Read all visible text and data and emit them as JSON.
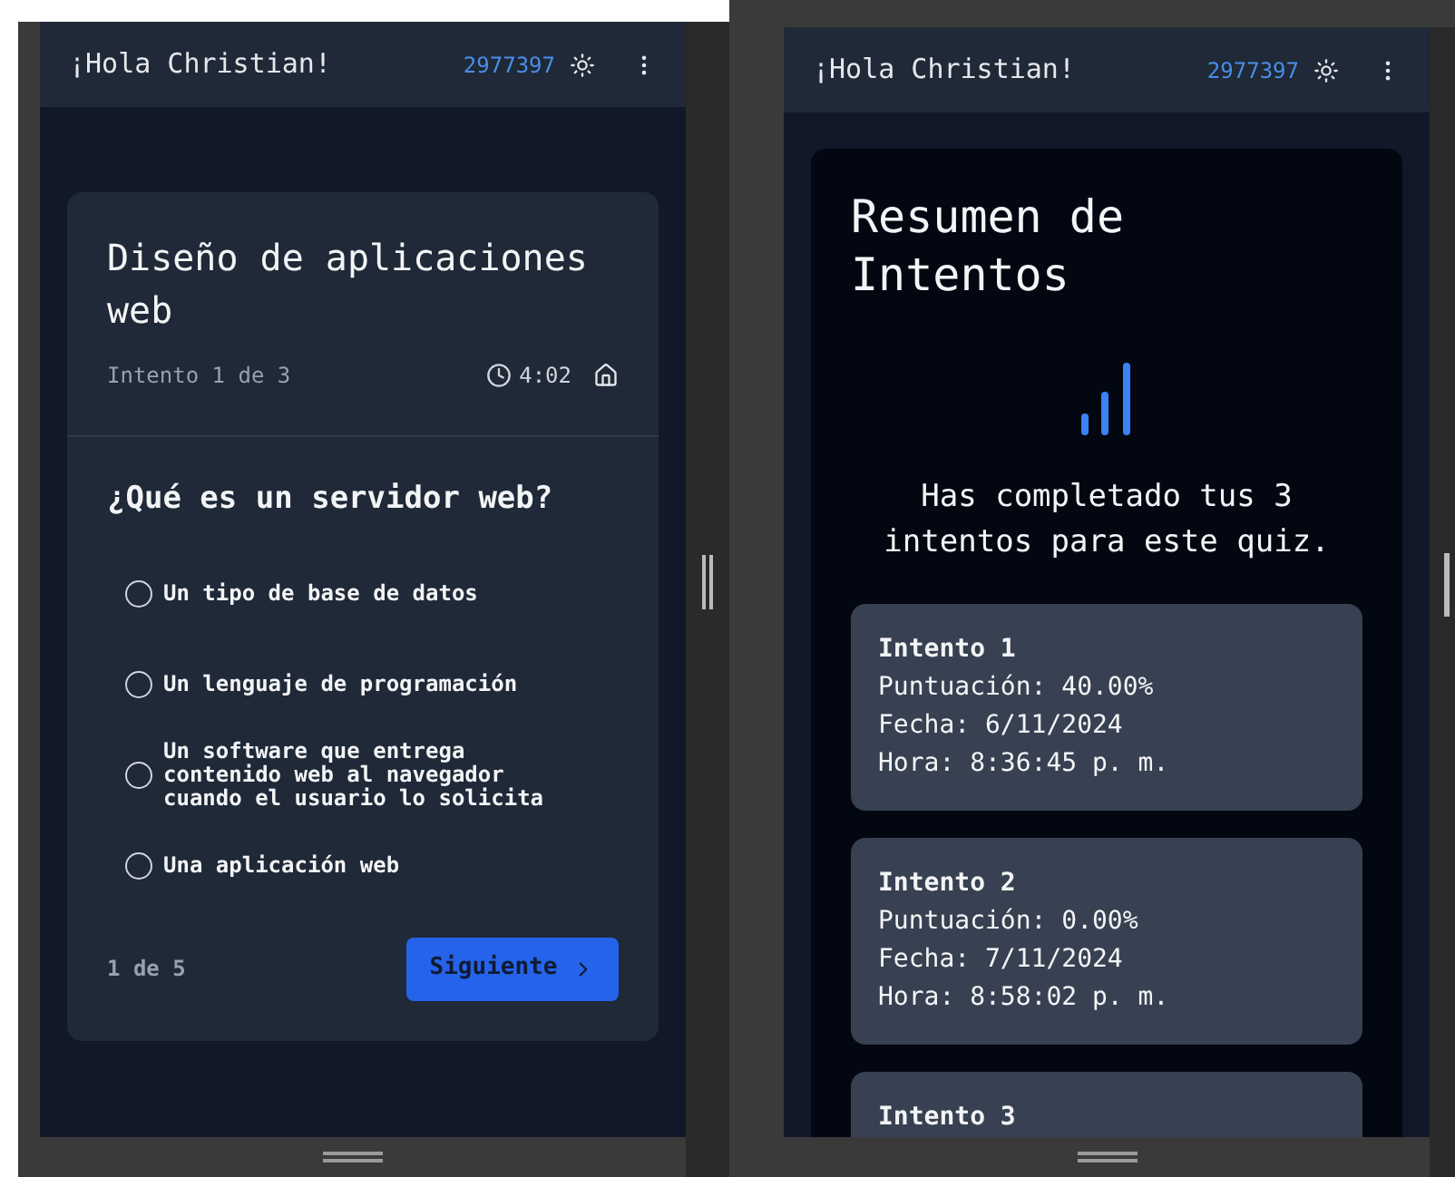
{
  "left_screen": {
    "header": {
      "greeting": "¡Hola Christian!",
      "user_id": "2977397"
    },
    "quiz": {
      "title": "Diseño de aplicaciones web",
      "attempt": "Intento 1 de 3",
      "timer": "4:02",
      "question": "¿Qué es un servidor web?",
      "options": [
        {
          "label": "Un tipo de base de datos",
          "selected": false
        },
        {
          "label": "Un lenguaje de programación",
          "selected": false
        },
        {
          "label": "Un software que entrega contenido web al navegador cuando el usuario lo solicita",
          "selected": false
        },
        {
          "label": "Una aplicación web",
          "selected": false
        }
      ],
      "progress": "1 de 5",
      "next_button": "Siguiente"
    }
  },
  "right_screen": {
    "header": {
      "greeting": "¡Hola Christian!",
      "user_id": "2977397"
    },
    "summary": {
      "title": "Resumen de Intentos",
      "message": "Has completado tus 3 intentos para este quiz.",
      "attempts": [
        {
          "title": "Intento 1",
          "lines": [
            "Puntuación: 40.00%",
            "Fecha: 6/11/2024",
            "Hora: 8:36:45 p. m."
          ]
        },
        {
          "title": "Intento 2",
          "lines": [
            "Puntuación: 0.00%",
            "Fecha: 7/11/2024",
            "Hora: 8:58:02 p. m."
          ]
        },
        {
          "title": "Intento 3"
        }
      ]
    }
  }
}
